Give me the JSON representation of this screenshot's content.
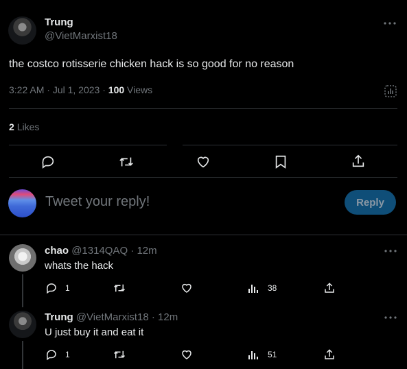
{
  "tweet": {
    "author_name": "Trung",
    "author_handle": "@VietMarxist18",
    "text": "the costco rotisserie chicken hack is so good for no reason",
    "time": "3:22 AM",
    "date": "Jul 1, 2023",
    "views_count": "100",
    "views_label": "Views",
    "likes_count": "2",
    "likes_label": "Likes",
    "separator": "·"
  },
  "reply_box": {
    "placeholder": "Tweet your reply!",
    "button_label": "Reply"
  },
  "replies": [
    {
      "name": "chao",
      "handle": "@1314QAQ",
      "age": "12m",
      "text": "whats the hack",
      "reply_count": "1",
      "views": "38"
    },
    {
      "name": "Trung",
      "handle": "@VietMarxist18",
      "age": "12m",
      "text": "U just buy it and eat it",
      "reply_count": "1",
      "views": "51"
    }
  ],
  "colors": {
    "background": "#000000",
    "text": "#e7e9ea",
    "muted": "#71767b",
    "divider": "#2f3336",
    "reply_button_bg": "#0f4e78",
    "reply_button_text": "#8b98a5"
  },
  "icons": [
    "more-icon",
    "analytics-icon",
    "comment-icon",
    "retweet-icon",
    "like-icon",
    "bookmark-icon",
    "share-icon",
    "views-icon"
  ]
}
